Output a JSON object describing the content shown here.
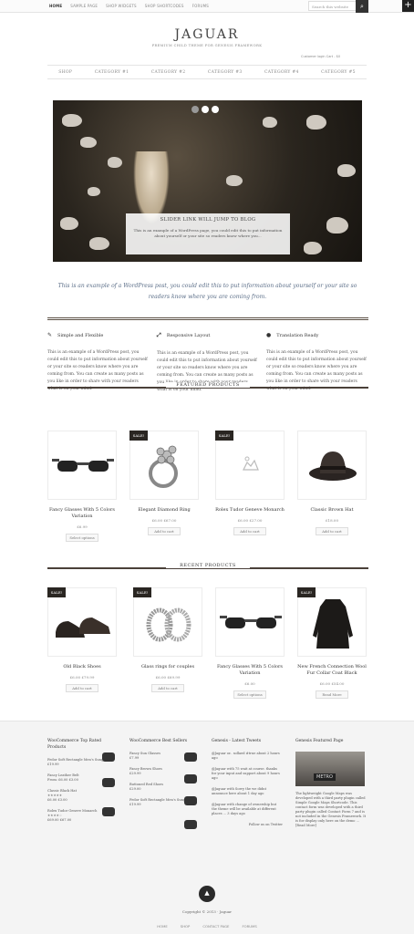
{
  "topbar": {
    "nav": [
      "HOME",
      "SAMPLE PAGE",
      "SHOP WIDGETS",
      "SHOP SHORTCODES",
      "FORUMS"
    ],
    "search_placeholder": "Search this website"
  },
  "header": {
    "logo": "JAGUAR",
    "tagline": "PREMIUM CHILD THEME FOR GENESIS FRAMEWORK",
    "cart": "Customer login     Cart - $0"
  },
  "nav": [
    "SHOP",
    "CATEGORY #1",
    "CATEGORY #2",
    "CATEGORY #3",
    "CATEGORY #4",
    "CATEGORY #5"
  ],
  "slider": {
    "title": "SLIDER LINK WILL JUMP TO BLOG",
    "text": "This is an example of a WordPress page, you could edit this to put information about yourself or your site so readers know where you..."
  },
  "intro": "This is an example of a WordPress post, you could edit this to put information about yourself or your site so readers know where you are coming from.",
  "features": [
    {
      "title": "Simple and Flexible",
      "text": "This is an example of a WordPress post, you could edit this to put information about yourself or your site so readers know where you are coming from. You can create as many posts as you like in order to share with your readers what is on your mind."
    },
    {
      "title": "Responsive Layout",
      "text": "This is an example of a WordPress post, you could edit this to put information about yourself or your site so readers know where you are coming from. You can create as many posts as you like in order to share with your readers what is on your mind."
    },
    {
      "title": "Translation Ready",
      "text": "This is an example of a WordPress post, you could edit this to put information about yourself or your site so readers know where you are coming from. You can create as many posts as you like in order to share with your readers what is on your mind."
    }
  ],
  "featured": {
    "heading": "FEATURED PRODUCTS",
    "sale": "SALE!",
    "items": [
      {
        "name": "Fancy Glasses With 5 Colors Variation",
        "price": "£6.99",
        "button": "Select options"
      },
      {
        "name": "Elegant Diamond Ring",
        "price": "£6.00 £67.00",
        "button": "Add to cart"
      },
      {
        "name": "Rolex Tudor Geneve Monarch",
        "price": "£6.00 £27.00",
        "button": "Add to cart"
      },
      {
        "name": "Classic Brown Hat",
        "price": "£18.00",
        "button": "Add to cart"
      }
    ]
  },
  "recent": {
    "heading": "RECENT PRODUCTS",
    "items": [
      {
        "name": "Old Black Shoes",
        "price": "£6.00 £79.99",
        "button": "Add to cart"
      },
      {
        "name": "Glass rings for couples",
        "price": "£6.00 £69.99",
        "button": "Add to cart"
      },
      {
        "name": "Fancy Glasses With 5 Colors Variation",
        "price": "£6.00",
        "button": "Select options"
      },
      {
        "name": "New French Connection Wool Fur Collar Coat Black",
        "price": "£6.00 £54.00",
        "button": "Read More"
      }
    ]
  },
  "footer": {
    "col1": {
      "title": "WooCommerce Top Rated Products",
      "items": [
        "Fedor Soft Rectangle Men's Sunglasses",
        "£19.99",
        "Fancy Leather Belt",
        "From: £6.00 £3.00",
        "Classic Black Hat",
        "£6.00 £3.00",
        "Rolex Tudor Geneve Monarch",
        "£69.00 £67.00"
      ]
    },
    "col2": {
      "title": "WooCommerce Best Sellers",
      "items": [
        "Fancy Sun Glasses",
        "£7.99",
        "Fancy Brown Shoes",
        "£29.99",
        "Buttoned Red Shoes",
        "£29.00",
        "Fedor Soft Rectangle Men's Sunglasses",
        "£19.99"
      ]
    },
    "col3": {
      "title": "Genesis - Latest Tweets",
      "items": [
        "@Jaguar or.. sollaed #true about 2 hours ago",
        "@Jaguar with 75 wait at course. thanks for your input and support about 9 hours ago",
        "@Jaguar with Sorry the we didnt announce here about 1 day ago",
        "@Jaguar with change of ownership but the theme will be available at different places ... 3 days ago",
        "Follow us on Twitter"
      ]
    },
    "col4": {
      "title": "Genesis Featured Page",
      "img_label": "METRO",
      "text": "The lightweight Google Maps was developed with a third party plugin called Simple Google Maps Shortcode. This contact form was developed with a third party plugin called Contact Form 7 and is not included in the Genesis Framework. It is for display only here on the demo ... [Read More]"
    },
    "copyright": "Copyright © 2013 · Jaguar",
    "nav": [
      "HOME",
      "SHOP",
      "CONTACT PAGE",
      "FORUMS"
    ]
  }
}
